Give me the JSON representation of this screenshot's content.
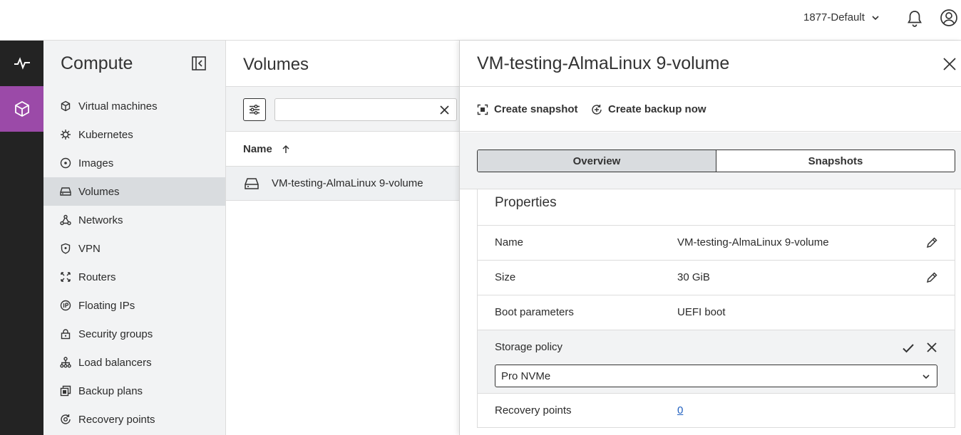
{
  "header": {
    "project": "1877-Default"
  },
  "sidebar": {
    "title": "Compute",
    "items": [
      {
        "label": "Virtual machines",
        "icon": "cube-icon"
      },
      {
        "label": "Kubernetes",
        "icon": "helm-icon"
      },
      {
        "label": "Images",
        "icon": "disc-icon"
      },
      {
        "label": "Volumes",
        "icon": "drive-icon",
        "active": true
      },
      {
        "label": "Networks",
        "icon": "network-icon"
      },
      {
        "label": "VPN",
        "icon": "shield-icon"
      },
      {
        "label": "Routers",
        "icon": "router-icon"
      },
      {
        "label": "Floating IPs",
        "icon": "ip-icon"
      },
      {
        "label": "Security groups",
        "icon": "lock-icon"
      },
      {
        "label": "Load balancers",
        "icon": "load-balancer-icon"
      },
      {
        "label": "Backup plans",
        "icon": "backup-icon"
      },
      {
        "label": "Recovery points",
        "icon": "recovery-icon"
      }
    ]
  },
  "list": {
    "title": "Volumes",
    "search_value": "",
    "column_name": "Name",
    "rows": [
      {
        "name": "VM-testing-AlmaLinux 9-volume"
      }
    ]
  },
  "panel": {
    "title": "VM-testing-AlmaLinux 9-volume",
    "actions": {
      "create_snapshot": "Create snapshot",
      "create_backup": "Create backup now"
    },
    "tabs": {
      "overview": "Overview",
      "snapshots": "Snapshots"
    },
    "properties": {
      "title": "Properties",
      "name_label": "Name",
      "name_value": "VM-testing-AlmaLinux 9-volume",
      "size_label": "Size",
      "size_value": "30 GiB",
      "boot_label": "Boot parameters",
      "boot_value": "UEFI boot",
      "storage_label": "Storage policy",
      "storage_value": "Pro NVMe",
      "recovery_label": "Recovery points",
      "recovery_value": "0"
    }
  },
  "colors": {
    "accent": "#9b4aa8",
    "rail": "#232323",
    "sidebar_bg": "#f2f3f4",
    "active_bg": "#d9dcdf",
    "link": "#1f5fbf"
  }
}
